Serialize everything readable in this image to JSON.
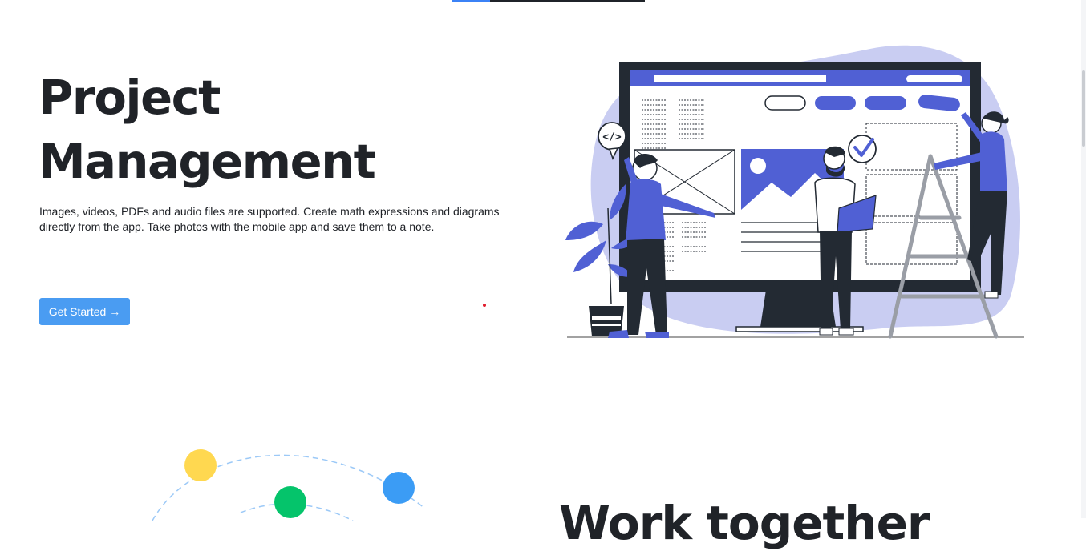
{
  "hero": {
    "title_line1": "Project",
    "title_line2": "Management",
    "description": "Images, videos, PDFs and audio files are supported. Create math expressions and diagrams directly from the app. Take photos with the mobile app and save them to a note.",
    "cta_label": "Get Started",
    "cta_arrow": "→"
  },
  "illustration": {
    "code_badge": "</>"
  },
  "section2": {
    "heading": "Work together"
  },
  "colors": {
    "accent": "#4a9cf2",
    "illustration_primary": "#5060d4",
    "illustration_blob": "#c9cdf2",
    "text": "#202328"
  },
  "icons": [
    "arrow-right-icon",
    "code-icon",
    "checkmark-icon"
  ]
}
